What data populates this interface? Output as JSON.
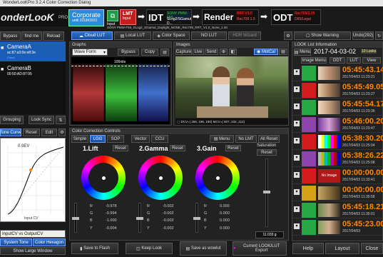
{
  "window": {
    "title": "WonderLooKPro 3.2.4 Color Correction Dialog"
  },
  "logo": {
    "text": "onderLooK",
    "pro": "PRO"
  },
  "header": {
    "project": "Corporate",
    "project_sub": "until 2018/03/31",
    "input_label": "Input",
    "lmt_label": "LMT",
    "lmt_sub": "Input",
    "idt_label": "IDT",
    "idt_sub1": "SONY PMW-F55",
    "idt_sub2": "SLog2/SGamut D...",
    "render_label": "Render",
    "render_sub1": "RRT V1.0",
    "render_sub2": "Rec709 1.0",
    "odt_label": "ODT",
    "odt_sub1": "Rec709/2.35",
    "odt_sub2": "D65/Legal",
    "status_line": "SONY PMW-F55_SLog2_SGamut_Daylight_NONE_Rec709_RRT_V1.0_None_1.00"
  },
  "toolbar": {
    "cloud_lut": "Cloud LUT",
    "local_lut": "Local LUT",
    "color_space": "Color Space",
    "no_lut": "NO LUT",
    "hdr_wizard": "HDR Wizard",
    "show_warning": "Show Warning",
    "undo": "Undo(292)",
    "bypass": "Bypass",
    "find_me": "find me",
    "reload": "Reload"
  },
  "cameras": [
    {
      "name": "CameraA",
      "mac": "ac:87:a3:0e:e8:3e",
      "sub": "Cloud"
    },
    {
      "name": "CameraB",
      "mac": "00:50:AD:87:95"
    }
  ],
  "left_controls": {
    "grouping": "Grouping",
    "look_sync": "Look Sync",
    "tone_curve": "Tone Curve",
    "reset": "Reset",
    "edit": "Edit",
    "curve_value": "0.9EV",
    "x_label": "Input CV",
    "curve_select": "InputCV vs OutputCV",
    "system_tone": "System Tone",
    "color_hexagon": "Color Hexagon",
    "show_large": "Show Large Window"
  },
  "graphs": {
    "title": "Graphs",
    "mode": "Wave Form",
    "bypass": "Bypass",
    "copy": "Copy",
    "label": "100nits"
  },
  "images": {
    "title": "Images",
    "capture": "Capture",
    "live": "Live",
    "send": "Send",
    "motcal": "MotCal",
    "status": "DCV=( 266, 196, 180) MCV=( 507, 232, 212)"
  },
  "ccc": {
    "title": "Color Correction Controls",
    "tabs": [
      "Simple",
      "LGG",
      "SOP",
      "Vector",
      "CCU"
    ],
    "menu": "Menu",
    "no_lmt": "No LMT",
    "all_reset": "All Reset",
    "lift": {
      "label": "1.Lift",
      "reset": "Reset",
      "r": "-0.978",
      "g": "-0.994",
      "b": "-1.000",
      "y": "-0.004"
    },
    "gamma": {
      "label": "2.Gamma",
      "reset": "Reset",
      "r": "-0.002",
      "g": "-0.002",
      "b": "-0.002",
      "y": "-0.002"
    },
    "gain": {
      "label": "3.Gain",
      "reset": "Reset",
      "r": "0.000",
      "g": "0.000",
      "b": "0.000",
      "y": "0.000"
    },
    "saturation": {
      "label": "Saturation",
      "reset": "Reset",
      "value": "11.033 g"
    },
    "channel_labels": [
      "R",
      "G",
      "B",
      "Y"
    ]
  },
  "bottom": {
    "save_flash": "Save to Flash",
    "keep_look": "Keep Look",
    "save_wowlut": "Save as wowlut",
    "export": "Current LOOK/LUT Export",
    "help": "Help",
    "layout": "Layout",
    "close": "Close"
  },
  "look_list": {
    "title": "LOOK List Information",
    "menu": "Menu",
    "date": "2017-04-03-02",
    "count": "10 Looks",
    "image_menu": "Image Menu",
    "odt": "ODT",
    "lut": "LUT",
    "view": "View",
    "items": [
      {
        "tc": "05:45:43.14",
        "date": "2017/04/03 11:23:21"
      },
      {
        "tc": "05:45:49.05",
        "date": "2017/04/03 11:23:27"
      },
      {
        "tc": "05:45:54.17",
        "date": "2017/04/03 11:23:36"
      },
      {
        "tc": "05:46:00.20",
        "date": "2017/04/03 11:23:47"
      },
      {
        "tc": "05:38:30.20",
        "date": "2017/04/03 11:25:04"
      },
      {
        "tc": "05:38:26.22",
        "date": "2017/04/03 11:25:08"
      },
      {
        "tc": "00:00:00.00",
        "date": "2017/04/03 11:33:41",
        "noimage": "No Image"
      },
      {
        "tc": "00:00:00.00",
        "date": "2017/04/03 11:35:58"
      },
      {
        "tc": "05:45:18.21",
        "date": "2017/04/03 11:35:01"
      },
      {
        "tc": "05:45:23.00",
        "date": "2017/04/03"
      }
    ]
  }
}
